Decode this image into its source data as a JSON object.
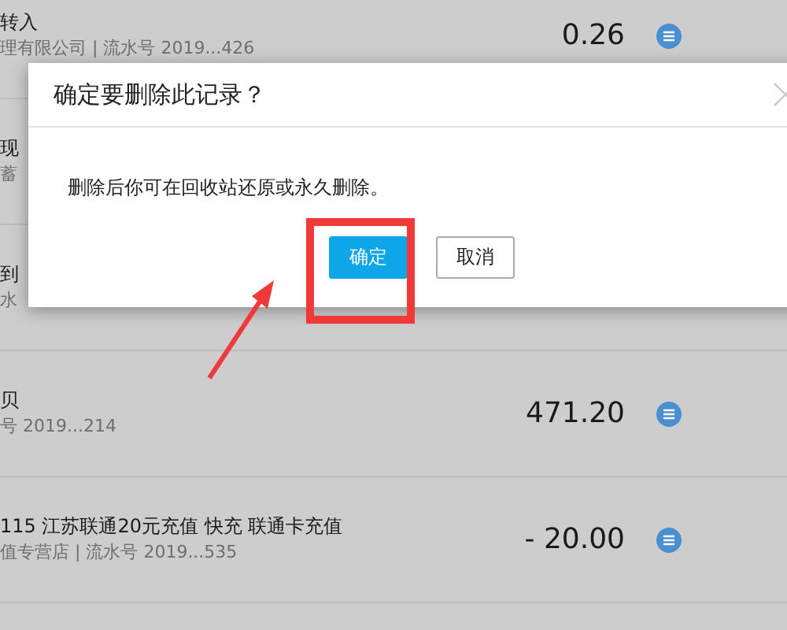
{
  "rows": [
    {
      "title": "转入",
      "subtitle": "理有限公司 | 流水号 2019...426",
      "amount": "0.26"
    },
    {
      "title": "现",
      "subtitle": "蓄"
    },
    {
      "title": "到",
      "subtitle": "水"
    },
    {
      "title": "贝",
      "subtitle": "号 2019...214",
      "amount": "471.20"
    },
    {
      "title": "115 江苏联通20元充值 快充 联通卡充值",
      "subtitle": "值专营店 | 流水号 2019...535",
      "amount": "- 20.00"
    }
  ],
  "dialog": {
    "title": "确定要删除此记录？",
    "message": "删除后你可在回收站还原或永久删除。",
    "buttons": [
      {
        "label": "确定",
        "kind": "primary"
      },
      {
        "label": "取消",
        "kind": "secondary"
      }
    ]
  }
}
